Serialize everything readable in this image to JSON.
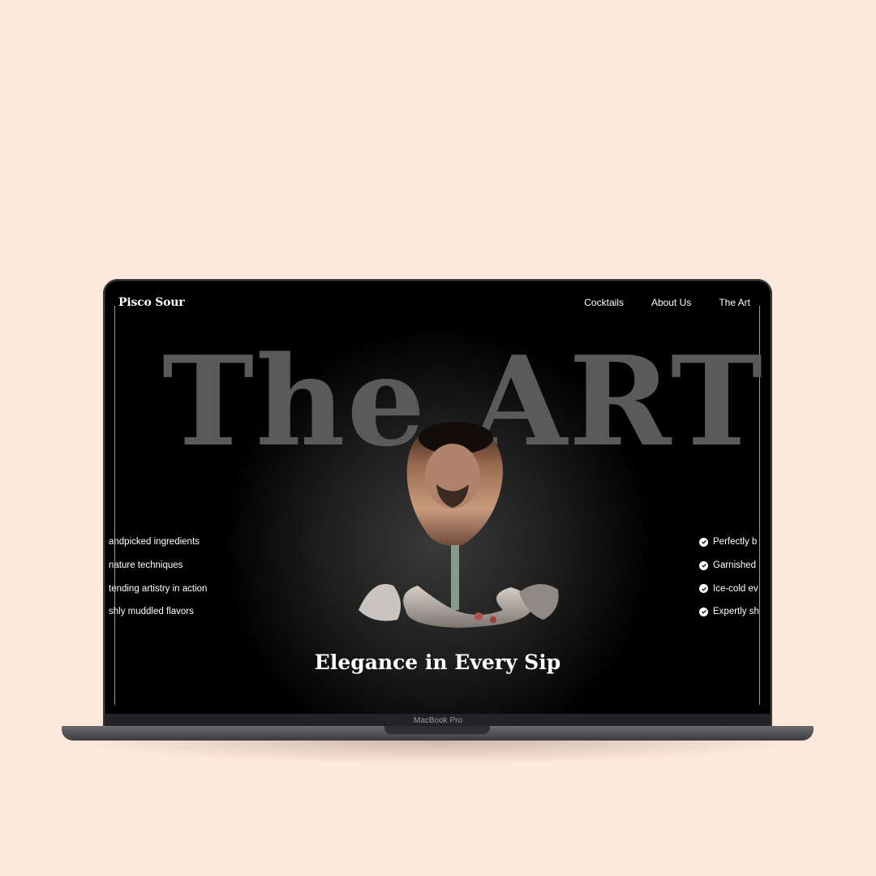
{
  "brand": {
    "logo": "Pisco Sour"
  },
  "nav": {
    "items": [
      "Cocktails",
      "About Us",
      "The Art"
    ]
  },
  "hero": {
    "title": "The ART",
    "tagline": "Elegance in Every Sip"
  },
  "left_features": [
    "andpicked ingredients",
    "nature techniques",
    "tending artistry in action",
    "shly muddled flavors"
  ],
  "right_features": [
    "Perfectly b",
    "Garnished",
    "Ice-cold ev",
    "Expertly sh"
  ],
  "device": {
    "label": "MacBook Pro"
  },
  "colors": {
    "background": "#fde8dc",
    "screen": "#000000",
    "title": "#5a5a5a",
    "text": "#ffffff"
  }
}
